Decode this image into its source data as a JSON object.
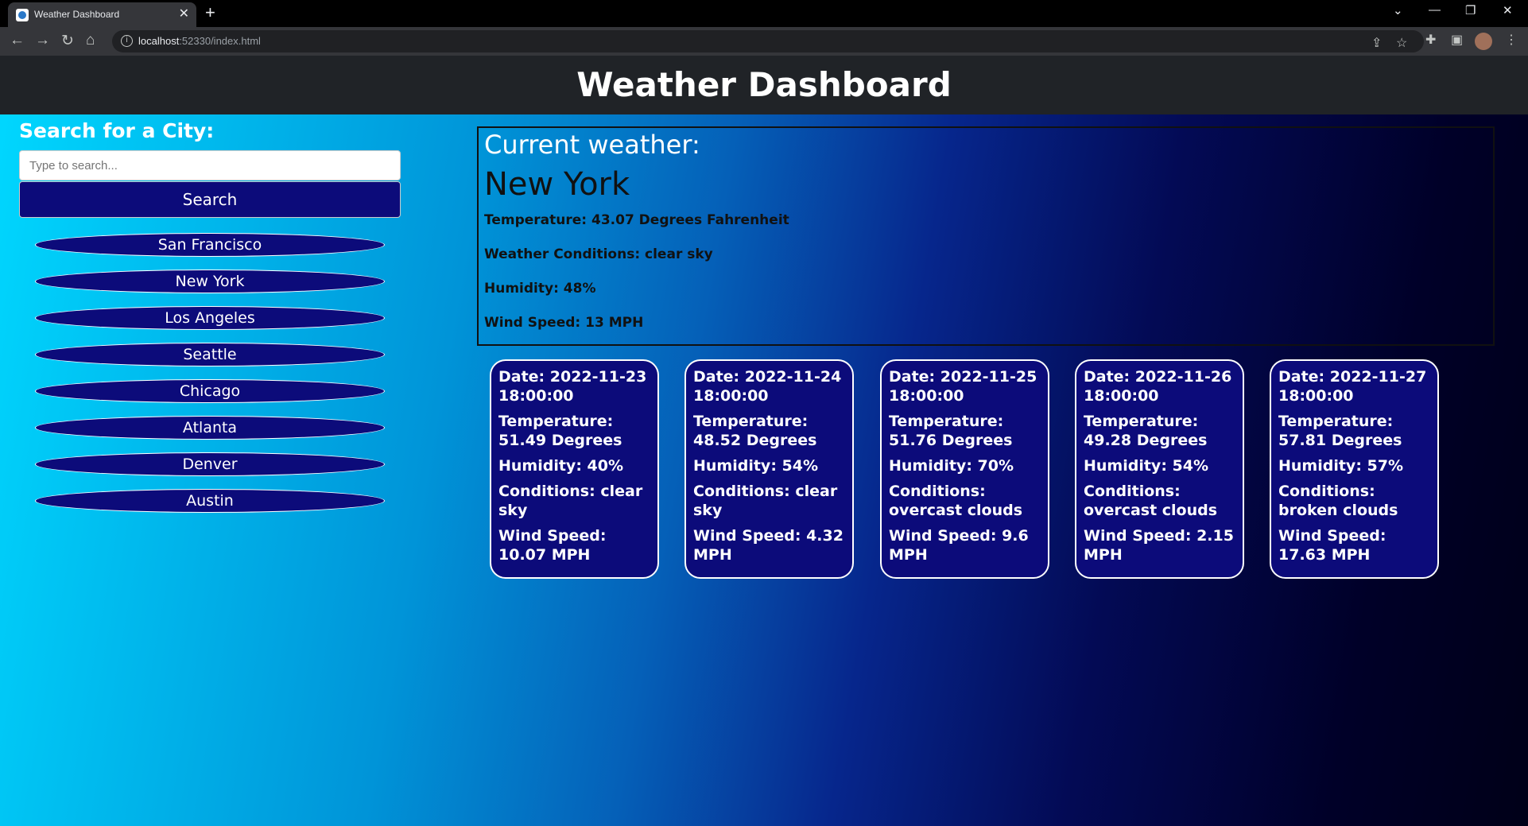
{
  "browser": {
    "tab_title": "Weather Dashboard",
    "url_host": "localhost",
    "url_rest": ":52330/index.html"
  },
  "header": {
    "title": "Weather Dashboard"
  },
  "search": {
    "label": "Search for a City:",
    "placeholder": "Type to search...",
    "button_label": "Search"
  },
  "cities": [
    "San Francisco",
    "New York",
    "Los Angeles",
    "Seattle",
    "Chicago",
    "Atlanta",
    "Denver",
    "Austin"
  ],
  "current": {
    "label": "Current weather:",
    "city": "New York",
    "temperature": "Temperature: 43.07 Degrees Fahrenheit",
    "conditions": "Weather Conditions: clear sky",
    "humidity": "Humidity: 48%",
    "wind": "Wind Speed: 13 MPH"
  },
  "forecast": [
    {
      "date": "Date: 2022-11-23 18:00:00",
      "temp": "Temperature: 51.49 Degrees",
      "humidity": "Humidity: 40%",
      "conditions": "Conditions: clear sky",
      "wind": "Wind Speed: 10.07 MPH"
    },
    {
      "date": "Date: 2022-11-24 18:00:00",
      "temp": "Temperature: 48.52 Degrees",
      "humidity": "Humidity: 54%",
      "conditions": "Conditions: clear sky",
      "wind": "Wind Speed: 4.32 MPH"
    },
    {
      "date": "Date: 2022-11-25 18:00:00",
      "temp": "Temperature: 51.76 Degrees",
      "humidity": "Humidity: 70%",
      "conditions": "Conditions: overcast clouds",
      "wind": "Wind Speed: 9.6 MPH"
    },
    {
      "date": "Date: 2022-11-26 18:00:00",
      "temp": "Temperature: 49.28 Degrees",
      "humidity": "Humidity: 54%",
      "conditions": "Conditions: overcast clouds",
      "wind": "Wind Speed: 2.15 MPH"
    },
    {
      "date": "Date: 2022-11-27 18:00:00",
      "temp": "Temperature: 57.81 Degrees",
      "humidity": "Humidity: 57%",
      "conditions": "Conditions: broken clouds",
      "wind": "Wind Speed: 17.63 MPH"
    }
  ]
}
